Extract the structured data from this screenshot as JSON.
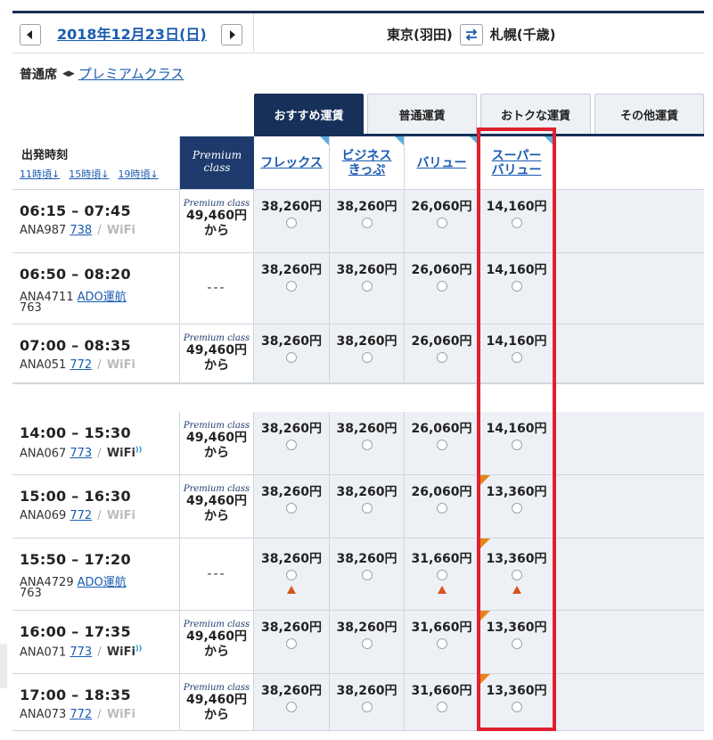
{
  "date_nav": {
    "prev_icon": "chevron-left-icon",
    "date": "2018年12月23日(日)",
    "next_icon": "chevron-right-icon"
  },
  "route": {
    "from": "東京(羽田)",
    "swap_icon": "swap-arrows-icon",
    "to": "札幌(千歳)"
  },
  "cabin": {
    "current": "普通席",
    "switch_icon": "double-arrow-icon",
    "other": "プレミアムクラス"
  },
  "tabs": [
    {
      "label": "おすすめ運賃",
      "active": true
    },
    {
      "label": "普通運賃",
      "active": false
    },
    {
      "label": "おトクな運賃",
      "active": false
    },
    {
      "label": "その他運賃",
      "active": false
    }
  ],
  "header": {
    "departure_title": "出発時刻",
    "jumps": [
      "11時頃",
      "15時頃",
      "19時頃"
    ],
    "premium_line1": "Premium",
    "premium_line2": "class",
    "fares": [
      {
        "line1": "フレックス",
        "line2": ""
      },
      {
        "line1": "ビジネス",
        "line2": "きっぷ"
      },
      {
        "line1": "バリュー",
        "line2": ""
      },
      {
        "line1": "スーパー",
        "line2": "バリュー"
      }
    ]
  },
  "premium_logo": "Premium class",
  "flights": [
    {
      "time": "06:15 – 07:45",
      "flight": "ANA987",
      "aircraft": "738",
      "sep": "/",
      "wifi": "WiFi",
      "wifi_on": false,
      "sub": "",
      "premium": {
        "price": "49,460円",
        "suffix": "から"
      },
      "fares": [
        "38,260円",
        "38,260円",
        "26,060円",
        "14,160円"
      ],
      "warn": [
        false,
        false,
        false,
        false
      ],
      "flag": false
    },
    {
      "time": "06:50 – 08:20",
      "flight": "ANA4711",
      "aircraft": "ADO運航",
      "sep": "",
      "wifi": "",
      "wifi_on": false,
      "sub": "763",
      "premium": null,
      "premium_dash": "---",
      "fares": [
        "38,260円",
        "38,260円",
        "26,060円",
        "14,160円"
      ],
      "warn": [
        false,
        false,
        false,
        false
      ],
      "flag": false
    },
    {
      "time": "07:00 – 08:35",
      "flight": "ANA051",
      "aircraft": "772",
      "sep": "/",
      "wifi": "WiFi",
      "wifi_on": false,
      "sub": "",
      "premium": {
        "price": "49,460円",
        "suffix": "から"
      },
      "fares": [
        "38,260円",
        "38,260円",
        "26,060円",
        "14,160円"
      ],
      "warn": [
        false,
        false,
        false,
        false
      ],
      "flag": false
    },
    {
      "time": "14:00 – 15:30",
      "flight": "ANA067",
      "aircraft": "773",
      "sep": "/",
      "wifi": "WiFi",
      "wifi_on": true,
      "sub": "",
      "premium": {
        "price": "49,460円",
        "suffix": "から"
      },
      "fares": [
        "38,260円",
        "38,260円",
        "26,060円",
        "14,160円"
      ],
      "warn": [
        false,
        false,
        false,
        false
      ],
      "flag": false
    },
    {
      "time": "15:00 – 16:30",
      "flight": "ANA069",
      "aircraft": "772",
      "sep": "/",
      "wifi": "WiFi",
      "wifi_on": false,
      "sub": "",
      "premium": {
        "price": "49,460円",
        "suffix": "から"
      },
      "fares": [
        "38,260円",
        "38,260円",
        "26,060円",
        "13,360円"
      ],
      "warn": [
        false,
        false,
        false,
        false
      ],
      "flag": true
    },
    {
      "time": "15:50 – 17:20",
      "flight": "ANA4729",
      "aircraft": "ADO運航",
      "sep": "",
      "wifi": "",
      "wifi_on": false,
      "sub": "763",
      "premium": null,
      "premium_dash": "---",
      "fares": [
        "38,260円",
        "38,260円",
        "31,660円",
        "13,360円"
      ],
      "warn": [
        true,
        false,
        true,
        true
      ],
      "flag": true
    },
    {
      "time": "16:00 – 17:35",
      "flight": "ANA071",
      "aircraft": "773",
      "sep": "/",
      "wifi": "WiFi",
      "wifi_on": true,
      "sub": "",
      "premium": {
        "price": "49,460円",
        "suffix": "から"
      },
      "fares": [
        "38,260円",
        "38,260円",
        "31,660円",
        "13,360円"
      ],
      "warn": [
        false,
        false,
        false,
        false
      ],
      "flag": true
    },
    {
      "time": "17:00 – 18:35",
      "flight": "ANA073",
      "aircraft": "772",
      "sep": "/",
      "wifi": "WiFi",
      "wifi_on": false,
      "sub": "",
      "premium": {
        "price": "49,460円",
        "suffix": "から"
      },
      "fares": [
        "38,260円",
        "38,260円",
        "31,660円",
        "13,360円"
      ],
      "warn": [
        false,
        false,
        false,
        false
      ],
      "flag": true
    }
  ],
  "colors": {
    "navy": "#17305a",
    "link": "#1a5bb0",
    "highlight": "#e0202e",
    "flag": "#e8831c",
    "warn": "#d8541a"
  }
}
